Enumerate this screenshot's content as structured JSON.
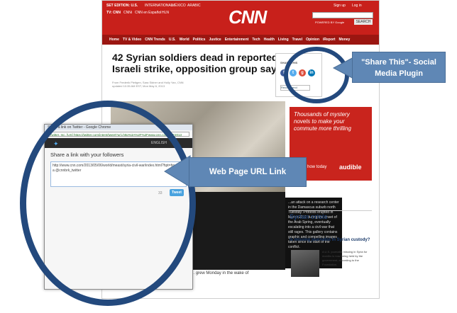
{
  "header": {
    "edition": "SET EDITION: U.S.",
    "edition_links": [
      "INTERNATIONAL",
      "MÉXICO",
      "ARABIC"
    ],
    "tv_links": [
      "TV: CNN",
      "CNNi",
      "CNN en Español",
      "HLN"
    ],
    "logo": "CNN",
    "signup": "Sign up",
    "login": "Log in",
    "search_button": "SEARCH",
    "powered": "POWERED BY Google"
  },
  "nav": {
    "items": [
      "Home",
      "TV & Video",
      "CNN Trends",
      "U.S.",
      "World",
      "Politics",
      "Justice",
      "Entertainment",
      "Tech",
      "Health",
      "Living",
      "Travel",
      "Opinion",
      "iReport",
      "Money"
    ]
  },
  "article": {
    "headline": "42 Syrian soldiers dead in reported Israeli strike, opposition group says",
    "byline": "From Frederik Pleitgen, Sara Sidner and Holly Yan, CNN",
    "updated": "updated 10:35 AM EST, Mon May 6, 2013",
    "caption": "...an attack on a research center in the Damascus suburb north Tuesday. Protests erupted in March 2011 during the onset of the Arab Spring, eventually escalating into a civil war that still rages. This gallery contains graphic and compelling images taken since the start of the conflict.",
    "bottom": "... Concern over the possibility of broader ... grew Monday in the wake of reported"
  },
  "share": {
    "title": "SHARE THIS",
    "recommend": "Recommend",
    "icons": [
      "facebook-icon",
      "twitter-icon",
      "google-plus-icon",
      "linkedin-icon"
    ],
    "colors": [
      "#3b5998",
      "#55acee",
      "#dd4b39",
      "#0077b5"
    ]
  },
  "ad": {
    "text": "Thousands of mystery novels to make your commute more thrilling",
    "learn": "Learn how today",
    "brand": "audible"
  },
  "sidebar": {
    "section": "Syrian crisis",
    "story_title": "Is missing journalist in Syrian custody?",
    "story_blurb": "A U.S. journalist missing in Syria for months is now being held by the government, according to the Foundation."
  },
  "twitter_popup": {
    "window_title": "Share a link on Twitter - Google Chrome",
    "address": "Twitter, Inc. [US] https://twitter.com/intent/tweet?url=http%3A%2F%2Fwww.cnn.com%2F2013",
    "user": "ENGLISH",
    "heading": "Share a link with your followers",
    "tweet_text": "http://www.cnn.com/2013/05/06/world/meast/syria-civil-war/index.html?hpt=hp_t1 via @cnnbrk_twitter",
    "char_count": "33",
    "tweet_button": "Tweet"
  },
  "annotations": {
    "share_callout": "\"Share This\"- Social Media Plugin",
    "url_callout": "Web Page URL Link",
    "ring_color": "#23497d",
    "callout_color": "#5f87b5"
  }
}
